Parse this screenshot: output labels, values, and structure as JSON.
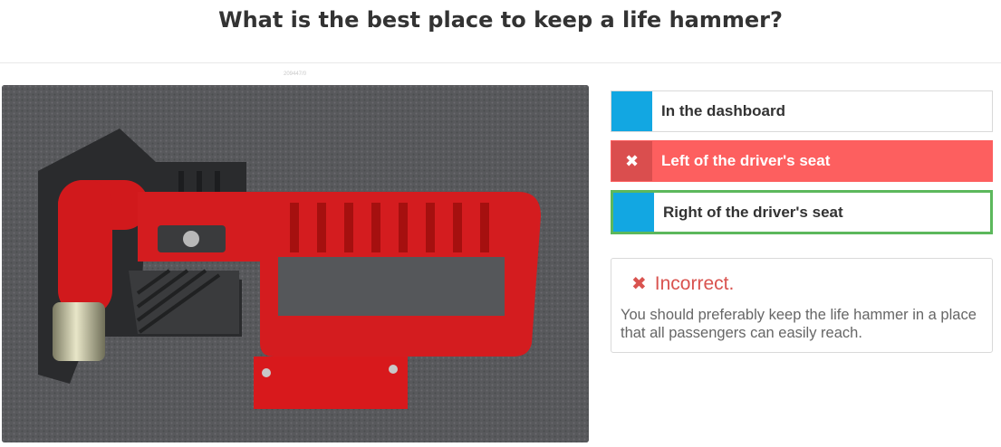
{
  "question": {
    "title": "What is the best place to keep a life hammer?"
  },
  "image": {
    "id_caption": "209447/0",
    "subject": "red life hammer on carpet"
  },
  "options": [
    {
      "label": "In the dashboard",
      "state": "neutral",
      "marker": ""
    },
    {
      "label": "Left of the driver's seat",
      "state": "selected-wrong",
      "marker": "✖"
    },
    {
      "label": "Right of the driver's seat",
      "state": "correct",
      "marker": ""
    }
  ],
  "feedback": {
    "icon": "✖",
    "status": "Incorrect.",
    "message": "You should preferably keep the life hammer in a place that all passengers can easily reach."
  },
  "colors": {
    "accent_blue": "#12a7e2",
    "wrong_red": "#fd5f5f",
    "wrong_marker": "#da4e4e",
    "correct_green": "#5cb85c",
    "error_text": "#d9534f"
  }
}
